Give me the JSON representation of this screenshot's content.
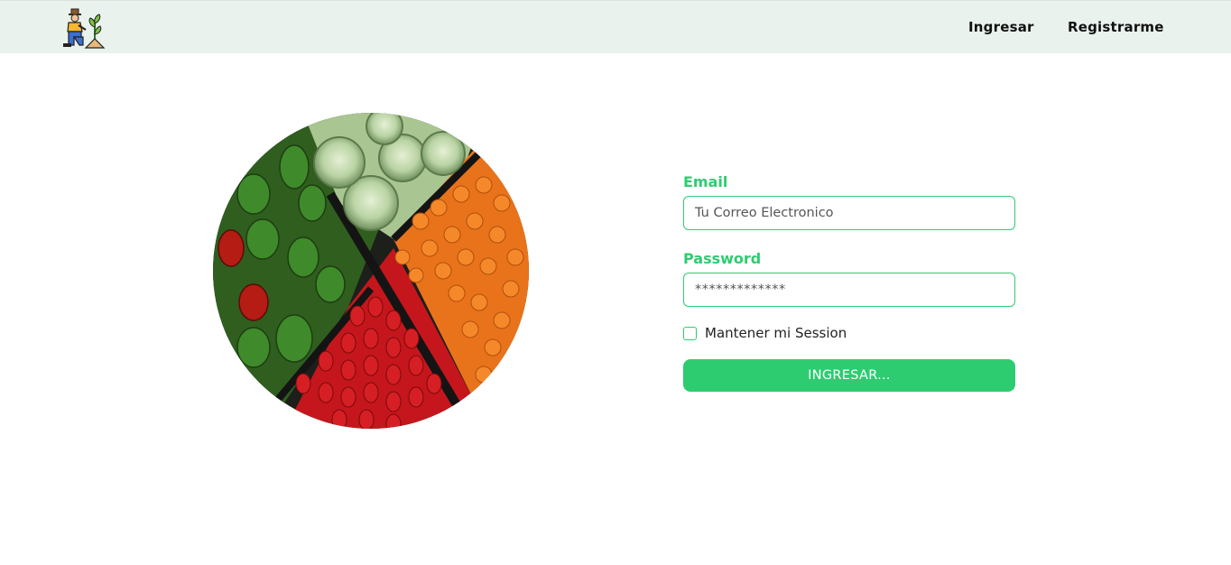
{
  "nav": {
    "ingresar_label": "Ingresar",
    "registrarme_label": "Registrarme"
  },
  "logo": {
    "icon": "farmer-planting-icon"
  },
  "hero": {
    "image": "vegetables-peppers-cabbage-photo"
  },
  "form": {
    "email_label": "Email",
    "email_placeholder": "Tu Correo Electronico",
    "password_label": "Password",
    "password_placeholder": "*************",
    "remember_label": "Mantener mi Session",
    "remember_checked": false,
    "submit_label": "INGRESAR..."
  },
  "colors": {
    "accent": "#2ecc71",
    "navbar_bg": "#e9f2ed"
  }
}
